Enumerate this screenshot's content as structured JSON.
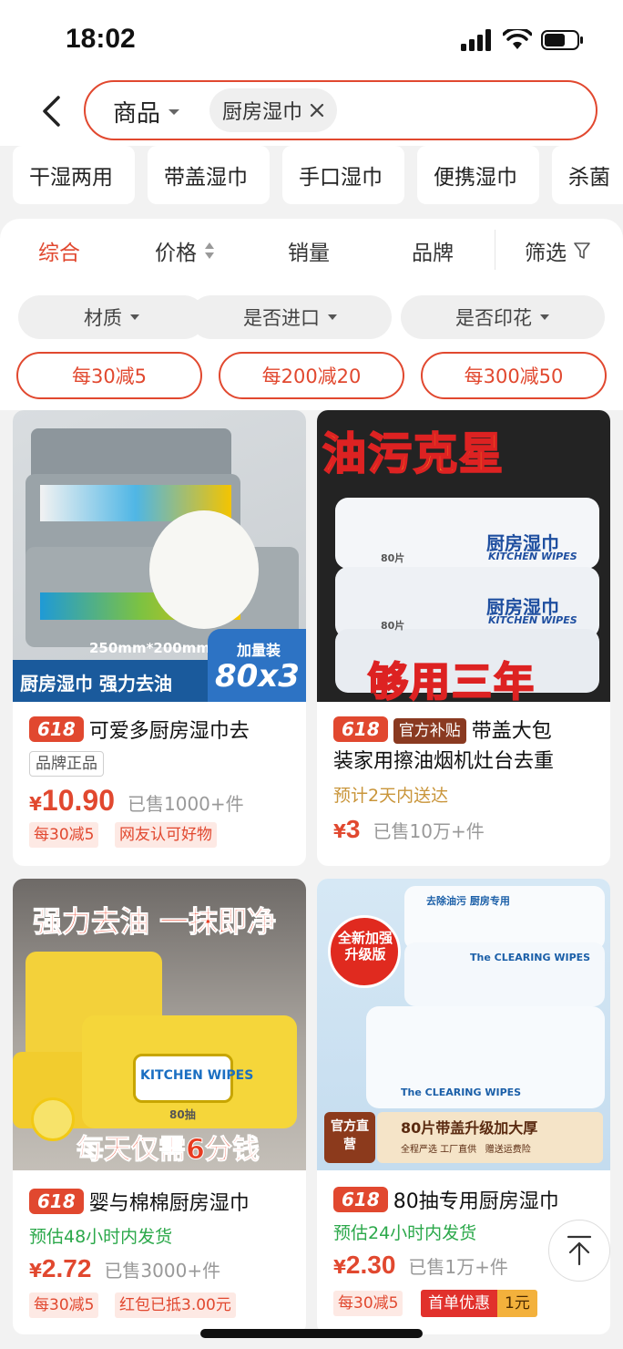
{
  "status_bar": {
    "time": "18:02"
  },
  "search": {
    "scope": "商品",
    "tag": "厨房湿巾"
  },
  "quick_filters": [
    "干湿两用",
    "带盖湿巾",
    "手口湿巾",
    "便携湿巾",
    "杀菌"
  ],
  "sort_tabs": [
    "综合",
    "价格",
    "销量",
    "品牌",
    "筛选"
  ],
  "attr_filters": [
    "材质",
    "是否进口",
    "是否印花"
  ],
  "promos": [
    "每30减5",
    "每200减20",
    "每300减50"
  ],
  "products": [
    {
      "image_text_1": "250mm*200mm",
      "image_text_2": "厨房湿巾 强力去油",
      "image_text_3": "加量装",
      "image_text_4": "80x3",
      "badge": "618",
      "title_1": "可爱多厨房湿巾去",
      "brand_tag": "品牌正品",
      "price_symbol": "¥",
      "price": "10.90",
      "sold": "已售1000+件",
      "tags": [
        "每30减5",
        "网友认可好物"
      ]
    },
    {
      "image_text_1": "油污克星",
      "image_text_2": "厨房湿巾",
      "image_text_3": "KITCHEN WIPES",
      "image_text_4": "够用三年",
      "image_text_5": "80片",
      "badge": "618",
      "subsidy": "官方补贴",
      "title_1": "带盖大包",
      "title_2": "装家用擦油烟机灶台去重",
      "delivery": "预计2天内送达",
      "price_symbol": "¥",
      "price": "3",
      "sold": "已售10万+件"
    },
    {
      "image_text_1": "强力去油 一抹即净",
      "image_text_2": "KITCHEN WIPES",
      "image_text_3": "每天仅需6分钱",
      "image_text_4": "80抽",
      "badge": "618",
      "title_1": "婴与棉棉厨房湿巾",
      "delivery": "预估48小时内发货",
      "price_symbol": "¥",
      "price": "2.72",
      "sold": "已售3000+件",
      "tags": [
        "每30减5",
        "红包已抵3.00元"
      ]
    },
    {
      "image_text_1": "全新加强升级版",
      "image_text_2": "去除油污 厨房专用",
      "image_text_3": "The CLEARING WIPES",
      "image_text_4": "官方直营",
      "image_text_5": "80片带盖升级加大厚",
      "image_text_6": "全程严选 工厂直供   赠送运费险",
      "badge": "618",
      "title_1": "80抽专用厨房湿巾",
      "delivery": "预估24小时内发货",
      "price_symbol": "¥",
      "price": "2.30",
      "sold": "已售1万+件",
      "tags": [
        "每30减5"
      ],
      "first_order": "首单优惠",
      "first_order_value": "1元"
    }
  ],
  "colors": {
    "accent": "#e1482f",
    "green": "#2ba84a",
    "orange_text": "#c9953a"
  }
}
